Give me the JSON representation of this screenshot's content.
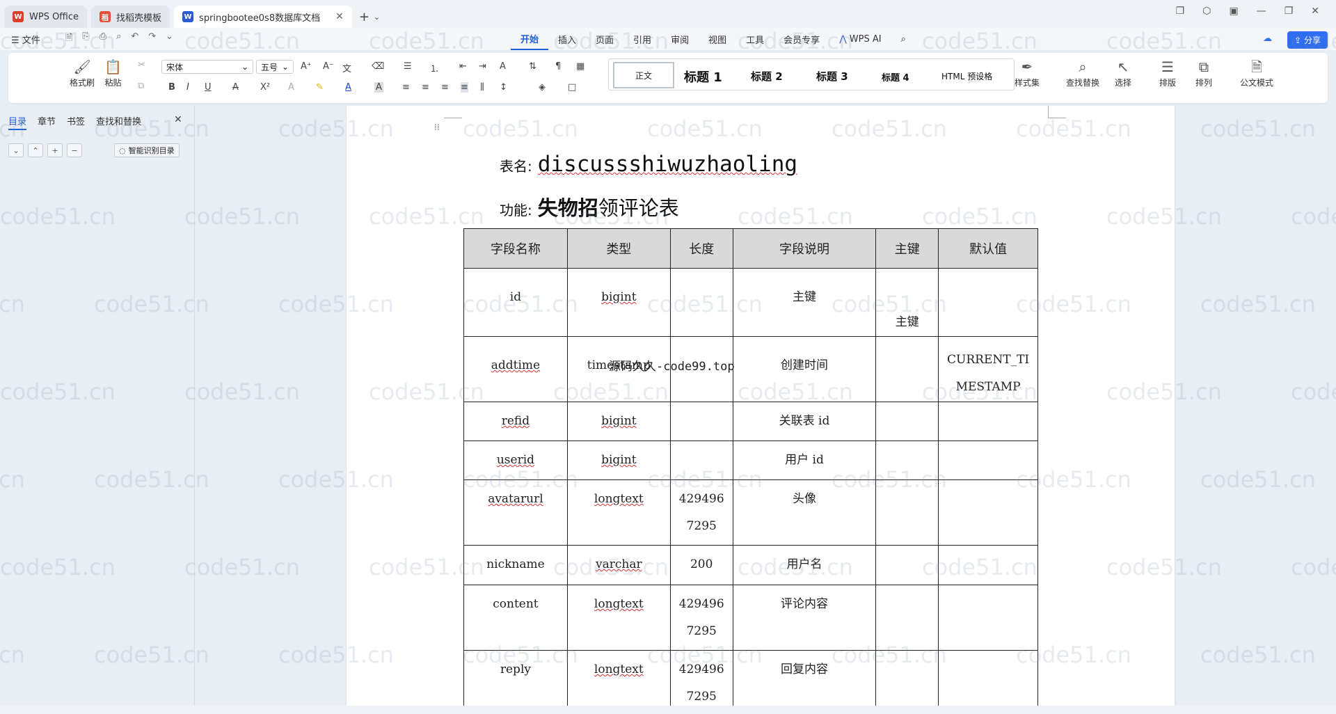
{
  "tabs": [
    {
      "label": "WPS Office",
      "icon": "wps-logo-icon"
    },
    {
      "label": "找稻壳模板",
      "icon": "docer-icon"
    },
    {
      "label": "springbootee0s8数据库文档",
      "icon": "word-doc-icon"
    }
  ],
  "menubar": {
    "file_label": "文件",
    "tabs": [
      "开始",
      "插入",
      "页面",
      "引用",
      "审阅",
      "视图",
      "工具",
      "会员专享"
    ],
    "wps_ai": "WPS AI",
    "share": "分享"
  },
  "ribbon": {
    "format_painter": "格式刷",
    "paste": "粘贴",
    "font_name": "宋体",
    "font_size": "五号",
    "styles": [
      "正文",
      "标题 1",
      "标题 2",
      "标题 3",
      "标题 4",
      "HTML 预设格"
    ],
    "style_set": "样式集",
    "find_replace": "查找替换",
    "select": "选择",
    "layout": "排版",
    "arrange": "排列",
    "official_mode": "公文模式"
  },
  "leftpane": {
    "tabs": [
      "目录",
      "章节",
      "书签",
      "查找和替换"
    ],
    "smart_toc": "智能识别目录"
  },
  "document": {
    "table_name_label": "表名:",
    "table_name": "discussshiwuzhaoling",
    "function_label": "功能:",
    "function_bold": "失物招",
    "function_rest": "领评论表",
    "overlay_text": "源码久久-code99.top",
    "columns": [
      "字段名称",
      "类型",
      "长度",
      "字段说明",
      "主键",
      "默认值"
    ],
    "rows": [
      {
        "name": "id",
        "type": "bigint",
        "length": "",
        "desc": "主键",
        "pk": "主键",
        "default": ""
      },
      {
        "name": "addtime",
        "type": "timestamp",
        "length": "",
        "desc": "创建时间",
        "pk": "",
        "default": "CURRENT_TIMESTAMP"
      },
      {
        "name": "refid",
        "type": "bigint",
        "length": "",
        "desc": "关联表 id",
        "pk": "",
        "default": ""
      },
      {
        "name": "userid",
        "type": "bigint",
        "length": "",
        "desc": "用户 id",
        "pk": "",
        "default": ""
      },
      {
        "name": "avatarurl",
        "type": "longtext",
        "length": "4294967295",
        "desc": "头像",
        "pk": "",
        "default": ""
      },
      {
        "name": "nickname",
        "type": "varchar",
        "length": "200",
        "desc": "用户名",
        "pk": "",
        "default": ""
      },
      {
        "name": "content",
        "type": "longtext",
        "length": "4294967295",
        "desc": "评论内容",
        "pk": "",
        "default": ""
      },
      {
        "name": "reply",
        "type": "longtext",
        "length": "4294967295",
        "desc": "回复内容",
        "pk": "",
        "default": ""
      }
    ]
  },
  "watermark": "code51.cn",
  "colors": {
    "accent": "#1f5fd9",
    "share": "#2f6ef2",
    "header_fill": "#d9d9d9"
  }
}
